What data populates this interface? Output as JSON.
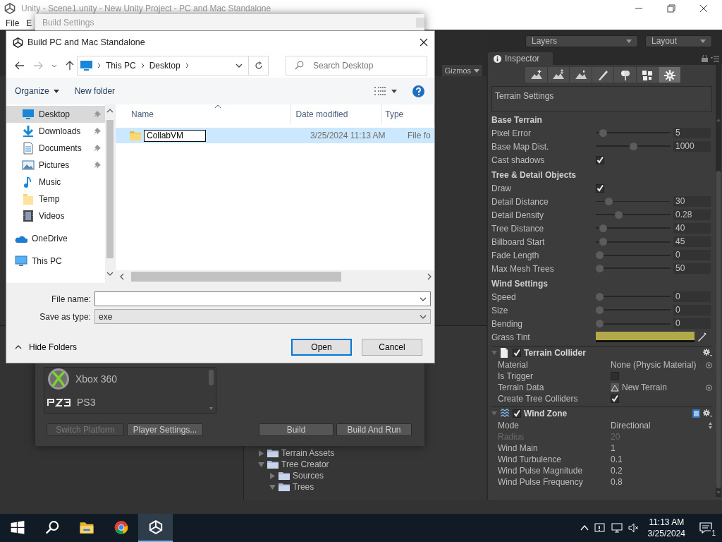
{
  "window": {
    "title": "Unity - Scene1.unity - New Unity Project - PC and Mac Standalone"
  },
  "menu": [
    "File",
    "E"
  ],
  "scene_toolbar": {
    "gizmos": "Gizmos"
  },
  "toolbar": {
    "layers": "Layers",
    "layout": "Layout"
  },
  "build_settings": {
    "title": "Build Settings",
    "platforms": [
      {
        "name": "Xbox 360",
        "kind": "xbox"
      },
      {
        "name": "PS3",
        "kind": "ps3"
      }
    ],
    "buttons": [
      {
        "label": "Switch Platform",
        "disabled": true
      },
      {
        "label": "Player Settings...",
        "disabled": false
      },
      {
        "label": "Build",
        "disabled": false
      },
      {
        "label": "Build And Run",
        "disabled": false
      }
    ]
  },
  "file_dialog": {
    "title": "Build PC and Mac Standalone",
    "breadcrumb": [
      "This PC",
      "Desktop"
    ],
    "search": {
      "placeholder": "Search Desktop"
    },
    "organize": "Organize",
    "new_folder": "New folder",
    "nav_items": [
      {
        "label": "Desktop",
        "kind": "desktop",
        "pinned": true,
        "selected": true
      },
      {
        "label": "Downloads",
        "kind": "downloads",
        "pinned": true,
        "selected": false
      },
      {
        "label": "Documents",
        "kind": "documents",
        "pinned": true,
        "selected": false
      },
      {
        "label": "Pictures",
        "kind": "pictures",
        "pinned": true,
        "selected": false
      },
      {
        "label": "Music",
        "kind": "music",
        "pinned": false,
        "selected": false
      },
      {
        "label": "Temp",
        "kind": "folder",
        "pinned": false,
        "selected": false
      },
      {
        "label": "Videos",
        "kind": "videos",
        "pinned": false,
        "selected": false
      },
      {
        "label": "OneDrive",
        "kind": "onedrive",
        "pinned": false,
        "selected": false
      },
      {
        "label": "This PC",
        "kind": "thispc",
        "pinned": false,
        "selected": false
      }
    ],
    "columns": [
      "Name",
      "Date modified",
      "Type"
    ],
    "rows": [
      {
        "name": "CollabVM",
        "date": "3/25/2024 11:13 AM",
        "type": "File fo",
        "selected": true,
        "renaming": true
      }
    ],
    "file_name": {
      "label": "File name:"
    },
    "save_as_type": {
      "label": "Save as type:",
      "value": "exe"
    },
    "hide_folders": "Hide Folders",
    "buttons": [
      {
        "label": "Open",
        "default": true
      },
      {
        "label": "Cancel",
        "default": false
      }
    ]
  },
  "inspector": {
    "tab": "Inspector",
    "tools": [
      {
        "kind": "raise",
        "selected": false
      },
      {
        "kind": "paint-height",
        "selected": false
      },
      {
        "kind": "smooth",
        "selected": false
      },
      {
        "kind": "brush",
        "selected": false
      },
      {
        "kind": "tree",
        "selected": false
      },
      {
        "kind": "detail",
        "selected": false
      },
      {
        "kind": "settings",
        "selected": true
      }
    ],
    "description": "Terrain Settings",
    "sections": [
      {
        "heading": "Base Terrain",
        "rows": [
          {
            "kind": "slider",
            "label": "Pixel Error",
            "level": 0.05,
            "value": "5"
          },
          {
            "kind": "slider",
            "label": "Base Map Dist.",
            "level": 0.5,
            "value": "1000"
          },
          {
            "kind": "checkbox",
            "label": "Cast shadows",
            "checked": true
          }
        ]
      },
      {
        "heading": "Tree & Detail Objects",
        "rows": [
          {
            "kind": "checkbox",
            "label": "Draw",
            "checked": true
          },
          {
            "kind": "slider",
            "label": "Detail Distance",
            "level": 0.14,
            "value": "30"
          },
          {
            "kind": "slider",
            "label": "Detail Density",
            "level": 0.28,
            "value": "0.28"
          },
          {
            "kind": "slider",
            "label": "Tree Distance",
            "level": 0.05,
            "value": "40"
          },
          {
            "kind": "slider",
            "label": "Billboard Start",
            "level": 0.05,
            "value": "45"
          },
          {
            "kind": "slider",
            "label": "Fade Length",
            "level": 0,
            "value": "0"
          },
          {
            "kind": "slider",
            "label": "Max Mesh Trees",
            "level": 0,
            "value": "50"
          }
        ]
      },
      {
        "heading": "Wind Settings",
        "rows": [
          {
            "kind": "slider",
            "label": "Speed",
            "level": 0,
            "value": "0"
          },
          {
            "kind": "slider",
            "label": "Size",
            "level": 0,
            "value": "0"
          },
          {
            "kind": "slider",
            "label": "Bending",
            "level": 0,
            "value": "0"
          },
          {
            "kind": "color",
            "label": "Grass Tint",
            "color": "#b3a94b"
          }
        ]
      }
    ],
    "components": [
      {
        "title": "Terrain Collider",
        "kind": "collider",
        "expanded": true,
        "enabled": true,
        "help": false,
        "rows": [
          {
            "kind": "object",
            "label": "Material",
            "value": "None (Physic Material)"
          },
          {
            "kind": "checkbox",
            "label": "Is Trigger",
            "checked": false
          },
          {
            "kind": "asset",
            "label": "Terrain Data",
            "value": "New Terrain"
          },
          {
            "kind": "checkbox",
            "label": "Create Tree Colliders",
            "checked": true
          }
        ]
      },
      {
        "title": "Wind Zone",
        "kind": "wind",
        "expanded": true,
        "enabled": true,
        "help": true,
        "rows": [
          {
            "kind": "dropdown",
            "label": "Mode",
            "value": "Directional"
          },
          {
            "kind": "value",
            "label": "Radius",
            "value": "20",
            "disabled": true
          },
          {
            "kind": "value",
            "label": "Wind Main",
            "value": "1",
            "disabled": false
          },
          {
            "kind": "value",
            "label": "Wind Turbulence",
            "value": "0.1",
            "disabled": false
          },
          {
            "kind": "value",
            "label": "Wind Pulse Magnitude",
            "value": "0.2",
            "disabled": false
          },
          {
            "kind": "value",
            "label": "Wind Pulse Frequency",
            "value": "0.8",
            "disabled": false
          }
        ]
      }
    ]
  },
  "project_tree": [
    {
      "label": "Terrain Assets",
      "expanded": false
    },
    {
      "label": "Tree Creator",
      "expanded": true,
      "children": [
        {
          "label": "Sources",
          "expanded": false
        },
        {
          "label": "Trees",
          "expanded": true
        }
      ]
    }
  ],
  "taskbar": {
    "apps": [
      {
        "kind": "start",
        "active": false
      },
      {
        "kind": "search",
        "active": false
      },
      {
        "kind": "explorer",
        "active": false
      },
      {
        "kind": "chrome",
        "active": false
      },
      {
        "kind": "unity",
        "active": true
      }
    ],
    "time": "11:13 AM",
    "date": "3/25/2024",
    "notifications": "1"
  }
}
